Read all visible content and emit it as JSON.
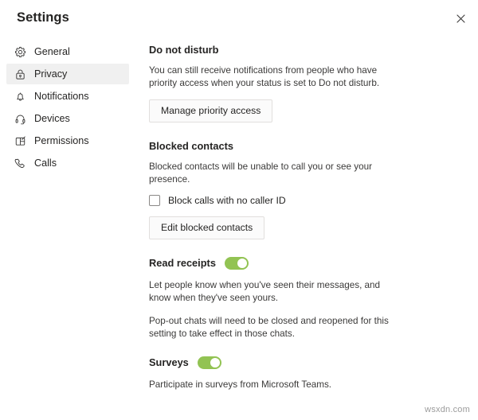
{
  "window": {
    "title": "Settings",
    "close_icon": "close-icon"
  },
  "sidebar": {
    "items": [
      {
        "label": "General",
        "icon": "gear-icon",
        "selected": false
      },
      {
        "label": "Privacy",
        "icon": "lock-icon",
        "selected": true
      },
      {
        "label": "Notifications",
        "icon": "bell-icon",
        "selected": false
      },
      {
        "label": "Devices",
        "icon": "headset-icon",
        "selected": false
      },
      {
        "label": "Permissions",
        "icon": "app-grid-icon",
        "selected": false
      },
      {
        "label": "Calls",
        "icon": "phone-icon",
        "selected": false
      }
    ]
  },
  "main": {
    "do_not_disturb": {
      "heading": "Do not disturb",
      "description": "You can still receive notifications from people who have priority access when your status is set to Do not disturb.",
      "button_label": "Manage priority access"
    },
    "blocked_contacts": {
      "heading": "Blocked contacts",
      "description": "Blocked contacts will be unable to call you or see your presence.",
      "checkbox_label": "Block calls with no caller ID",
      "checkbox_checked": "false",
      "button_label": "Edit blocked contacts"
    },
    "read_receipts": {
      "label": "Read receipts",
      "toggle_state": "on",
      "description_1": "Let people know when you've seen their messages, and know when they've seen yours.",
      "description_2": "Pop-out chats will need to be closed and reopened for this setting to take effect in those chats."
    },
    "surveys": {
      "label": "Surveys",
      "toggle_state": "on",
      "description": "Participate in surveys from Microsoft Teams."
    }
  },
  "watermark": {
    "text": "wsxdn.com"
  },
  "colors": {
    "toggle_on": "#92c353",
    "selected_nav_bg": "#f0f0f0",
    "text_primary": "#252423",
    "text_secondary": "#3b3a39",
    "button_border": "#e1dfdd"
  }
}
